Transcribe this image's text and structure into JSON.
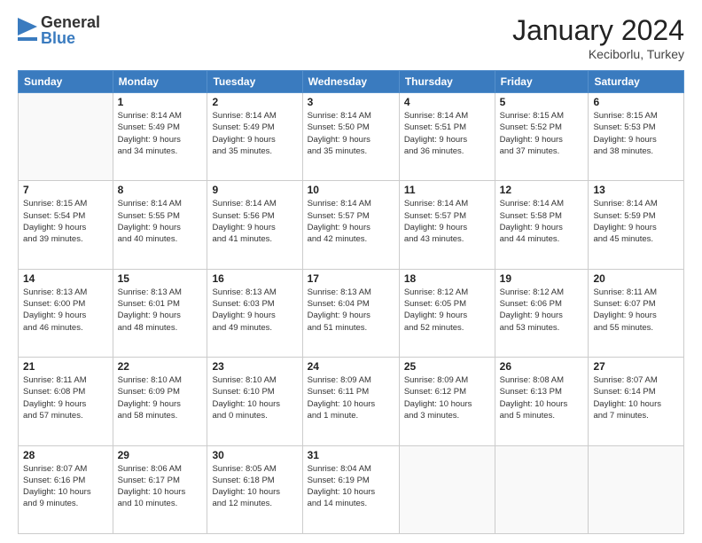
{
  "header": {
    "logo_general": "General",
    "logo_blue": "Blue",
    "month_title": "January 2024",
    "location": "Keciborlu, Turkey"
  },
  "weekdays": [
    "Sunday",
    "Monday",
    "Tuesday",
    "Wednesday",
    "Thursday",
    "Friday",
    "Saturday"
  ],
  "weeks": [
    [
      {
        "day": "",
        "info": ""
      },
      {
        "day": "1",
        "info": "Sunrise: 8:14 AM\nSunset: 5:49 PM\nDaylight: 9 hours\nand 34 minutes."
      },
      {
        "day": "2",
        "info": "Sunrise: 8:14 AM\nSunset: 5:49 PM\nDaylight: 9 hours\nand 35 minutes."
      },
      {
        "day": "3",
        "info": "Sunrise: 8:14 AM\nSunset: 5:50 PM\nDaylight: 9 hours\nand 35 minutes."
      },
      {
        "day": "4",
        "info": "Sunrise: 8:14 AM\nSunset: 5:51 PM\nDaylight: 9 hours\nand 36 minutes."
      },
      {
        "day": "5",
        "info": "Sunrise: 8:15 AM\nSunset: 5:52 PM\nDaylight: 9 hours\nand 37 minutes."
      },
      {
        "day": "6",
        "info": "Sunrise: 8:15 AM\nSunset: 5:53 PM\nDaylight: 9 hours\nand 38 minutes."
      }
    ],
    [
      {
        "day": "7",
        "info": "Sunrise: 8:15 AM\nSunset: 5:54 PM\nDaylight: 9 hours\nand 39 minutes."
      },
      {
        "day": "8",
        "info": "Sunrise: 8:14 AM\nSunset: 5:55 PM\nDaylight: 9 hours\nand 40 minutes."
      },
      {
        "day": "9",
        "info": "Sunrise: 8:14 AM\nSunset: 5:56 PM\nDaylight: 9 hours\nand 41 minutes."
      },
      {
        "day": "10",
        "info": "Sunrise: 8:14 AM\nSunset: 5:57 PM\nDaylight: 9 hours\nand 42 minutes."
      },
      {
        "day": "11",
        "info": "Sunrise: 8:14 AM\nSunset: 5:57 PM\nDaylight: 9 hours\nand 43 minutes."
      },
      {
        "day": "12",
        "info": "Sunrise: 8:14 AM\nSunset: 5:58 PM\nDaylight: 9 hours\nand 44 minutes."
      },
      {
        "day": "13",
        "info": "Sunrise: 8:14 AM\nSunset: 5:59 PM\nDaylight: 9 hours\nand 45 minutes."
      }
    ],
    [
      {
        "day": "14",
        "info": "Sunrise: 8:13 AM\nSunset: 6:00 PM\nDaylight: 9 hours\nand 46 minutes."
      },
      {
        "day": "15",
        "info": "Sunrise: 8:13 AM\nSunset: 6:01 PM\nDaylight: 9 hours\nand 48 minutes."
      },
      {
        "day": "16",
        "info": "Sunrise: 8:13 AM\nSunset: 6:03 PM\nDaylight: 9 hours\nand 49 minutes."
      },
      {
        "day": "17",
        "info": "Sunrise: 8:13 AM\nSunset: 6:04 PM\nDaylight: 9 hours\nand 51 minutes."
      },
      {
        "day": "18",
        "info": "Sunrise: 8:12 AM\nSunset: 6:05 PM\nDaylight: 9 hours\nand 52 minutes."
      },
      {
        "day": "19",
        "info": "Sunrise: 8:12 AM\nSunset: 6:06 PM\nDaylight: 9 hours\nand 53 minutes."
      },
      {
        "day": "20",
        "info": "Sunrise: 8:11 AM\nSunset: 6:07 PM\nDaylight: 9 hours\nand 55 minutes."
      }
    ],
    [
      {
        "day": "21",
        "info": "Sunrise: 8:11 AM\nSunset: 6:08 PM\nDaylight: 9 hours\nand 57 minutes."
      },
      {
        "day": "22",
        "info": "Sunrise: 8:10 AM\nSunset: 6:09 PM\nDaylight: 9 hours\nand 58 minutes."
      },
      {
        "day": "23",
        "info": "Sunrise: 8:10 AM\nSunset: 6:10 PM\nDaylight: 10 hours\nand 0 minutes."
      },
      {
        "day": "24",
        "info": "Sunrise: 8:09 AM\nSunset: 6:11 PM\nDaylight: 10 hours\nand 1 minute."
      },
      {
        "day": "25",
        "info": "Sunrise: 8:09 AM\nSunset: 6:12 PM\nDaylight: 10 hours\nand 3 minutes."
      },
      {
        "day": "26",
        "info": "Sunrise: 8:08 AM\nSunset: 6:13 PM\nDaylight: 10 hours\nand 5 minutes."
      },
      {
        "day": "27",
        "info": "Sunrise: 8:07 AM\nSunset: 6:14 PM\nDaylight: 10 hours\nand 7 minutes."
      }
    ],
    [
      {
        "day": "28",
        "info": "Sunrise: 8:07 AM\nSunset: 6:16 PM\nDaylight: 10 hours\nand 9 minutes."
      },
      {
        "day": "29",
        "info": "Sunrise: 8:06 AM\nSunset: 6:17 PM\nDaylight: 10 hours\nand 10 minutes."
      },
      {
        "day": "30",
        "info": "Sunrise: 8:05 AM\nSunset: 6:18 PM\nDaylight: 10 hours\nand 12 minutes."
      },
      {
        "day": "31",
        "info": "Sunrise: 8:04 AM\nSunset: 6:19 PM\nDaylight: 10 hours\nand 14 minutes."
      },
      {
        "day": "",
        "info": ""
      },
      {
        "day": "",
        "info": ""
      },
      {
        "day": "",
        "info": ""
      }
    ]
  ]
}
